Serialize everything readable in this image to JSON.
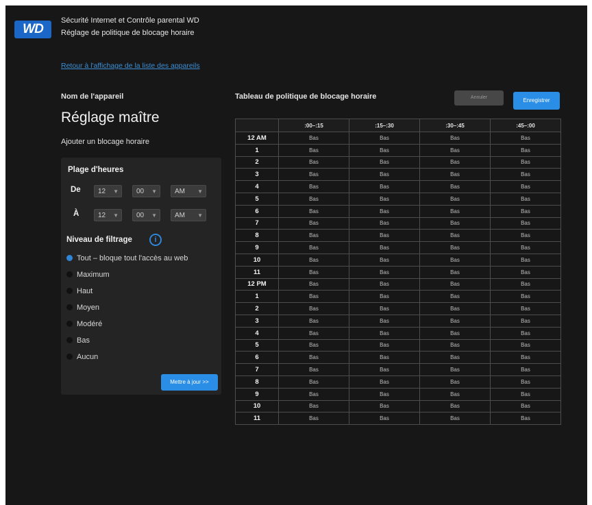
{
  "header": {
    "logo": "WD",
    "title": "Sécurité Internet et Contrôle parental WD",
    "subtitle": "Réglage de politique de blocage horaire"
  },
  "back_link": "Retour à l'affichage de la liste des appareils",
  "device": {
    "label": "Nom de l'appareil",
    "name": "Réglage maître"
  },
  "add_block": {
    "title": "Ajouter un blocage horaire",
    "range_title": "Plage d'heures",
    "from_label": "De",
    "to_label": "À",
    "from": {
      "hour": "12",
      "minute": "00",
      "ampm": "AM"
    },
    "to": {
      "hour": "12",
      "minute": "00",
      "ampm": "AM"
    },
    "filter_title": "Niveau de filtrage",
    "options": [
      {
        "label": "Tout – bloque tout l'accès au web",
        "selected": true
      },
      {
        "label": "Maximum",
        "selected": false
      },
      {
        "label": "Haut",
        "selected": false
      },
      {
        "label": "Moyen",
        "selected": false
      },
      {
        "label": "Modéré",
        "selected": false
      },
      {
        "label": "Bas",
        "selected": false
      },
      {
        "label": "Aucun",
        "selected": false
      }
    ],
    "apply_label": "Mettre à jour >>"
  },
  "schedule": {
    "title": "Tableau de politique de blocage horaire",
    "cancel_label": "Annuler",
    "save_label": "Enregistrer",
    "columns": [
      ":00–:15",
      ":15–:30",
      ":30–:45",
      ":45–:00"
    ],
    "rows": [
      {
        "hour": "12 AM",
        "cells": [
          "Bas",
          "Bas",
          "Bas",
          "Bas"
        ]
      },
      {
        "hour": "1",
        "cells": [
          "Bas",
          "Bas",
          "Bas",
          "Bas"
        ]
      },
      {
        "hour": "2",
        "cells": [
          "Bas",
          "Bas",
          "Bas",
          "Bas"
        ]
      },
      {
        "hour": "3",
        "cells": [
          "Bas",
          "Bas",
          "Bas",
          "Bas"
        ]
      },
      {
        "hour": "4",
        "cells": [
          "Bas",
          "Bas",
          "Bas",
          "Bas"
        ]
      },
      {
        "hour": "5",
        "cells": [
          "Bas",
          "Bas",
          "Bas",
          "Bas"
        ]
      },
      {
        "hour": "6",
        "cells": [
          "Bas",
          "Bas",
          "Bas",
          "Bas"
        ]
      },
      {
        "hour": "7",
        "cells": [
          "Bas",
          "Bas",
          "Bas",
          "Bas"
        ]
      },
      {
        "hour": "8",
        "cells": [
          "Bas",
          "Bas",
          "Bas",
          "Bas"
        ]
      },
      {
        "hour": "9",
        "cells": [
          "Bas",
          "Bas",
          "Bas",
          "Bas"
        ]
      },
      {
        "hour": "10",
        "cells": [
          "Bas",
          "Bas",
          "Bas",
          "Bas"
        ]
      },
      {
        "hour": "11",
        "cells": [
          "Bas",
          "Bas",
          "Bas",
          "Bas"
        ]
      },
      {
        "hour": "12 PM",
        "cells": [
          "Bas",
          "Bas",
          "Bas",
          "Bas"
        ]
      },
      {
        "hour": "1",
        "cells": [
          "Bas",
          "Bas",
          "Bas",
          "Bas"
        ]
      },
      {
        "hour": "2",
        "cells": [
          "Bas",
          "Bas",
          "Bas",
          "Bas"
        ]
      },
      {
        "hour": "3",
        "cells": [
          "Bas",
          "Bas",
          "Bas",
          "Bas"
        ]
      },
      {
        "hour": "4",
        "cells": [
          "Bas",
          "Bas",
          "Bas",
          "Bas"
        ]
      },
      {
        "hour": "5",
        "cells": [
          "Bas",
          "Bas",
          "Bas",
          "Bas"
        ]
      },
      {
        "hour": "6",
        "cells": [
          "Bas",
          "Bas",
          "Bas",
          "Bas"
        ]
      },
      {
        "hour": "7",
        "cells": [
          "Bas",
          "Bas",
          "Bas",
          "Bas"
        ]
      },
      {
        "hour": "8",
        "cells": [
          "Bas",
          "Bas",
          "Bas",
          "Bas"
        ]
      },
      {
        "hour": "9",
        "cells": [
          "Bas",
          "Bas",
          "Bas",
          "Bas"
        ]
      },
      {
        "hour": "10",
        "cells": [
          "Bas",
          "Bas",
          "Bas",
          "Bas"
        ]
      },
      {
        "hour": "11",
        "cells": [
          "Bas",
          "Bas",
          "Bas",
          "Bas"
        ]
      }
    ]
  },
  "colors": {
    "background": "#171717",
    "panel": "#242424",
    "accent": "#2b8ee6",
    "link": "#3c8fd6"
  }
}
